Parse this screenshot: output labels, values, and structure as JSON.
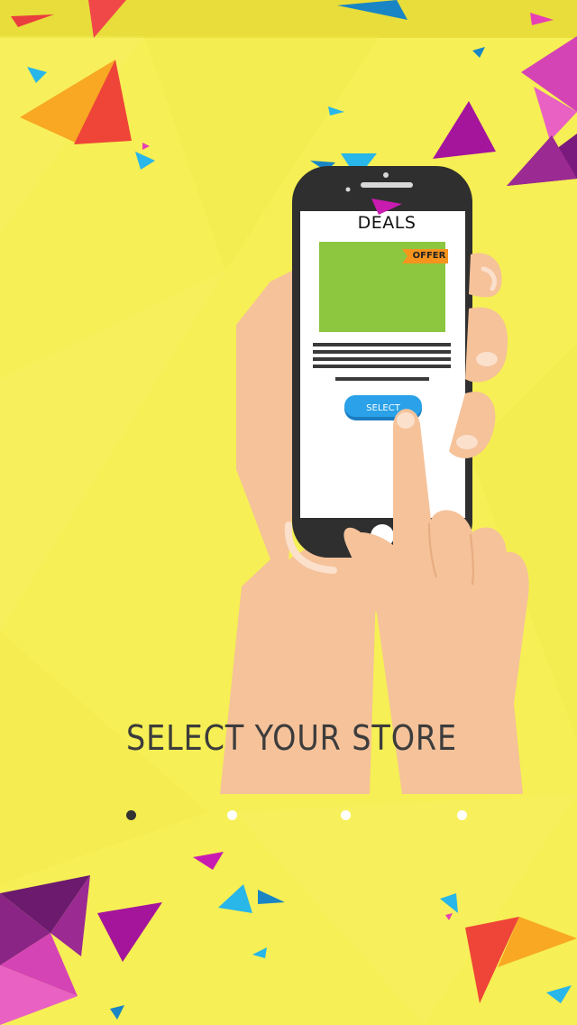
{
  "colors": {
    "background": "#f6ef55",
    "title": "#3c3c3c",
    "phone_body": "#2f2f2f",
    "deal_image": "#8dc63f",
    "offer_badge": "#f7941d",
    "select_button": "#2aa1e8",
    "skin": "#f5c29a"
  },
  "phone": {
    "screen_title": "DEALS",
    "offer_label": "OFFER",
    "select_label": "SELECT"
  },
  "onboarding": {
    "title": "SELECT YOUR STORE",
    "pages": [
      {
        "active": true
      },
      {
        "active": false
      },
      {
        "active": false
      },
      {
        "active": false
      }
    ]
  }
}
